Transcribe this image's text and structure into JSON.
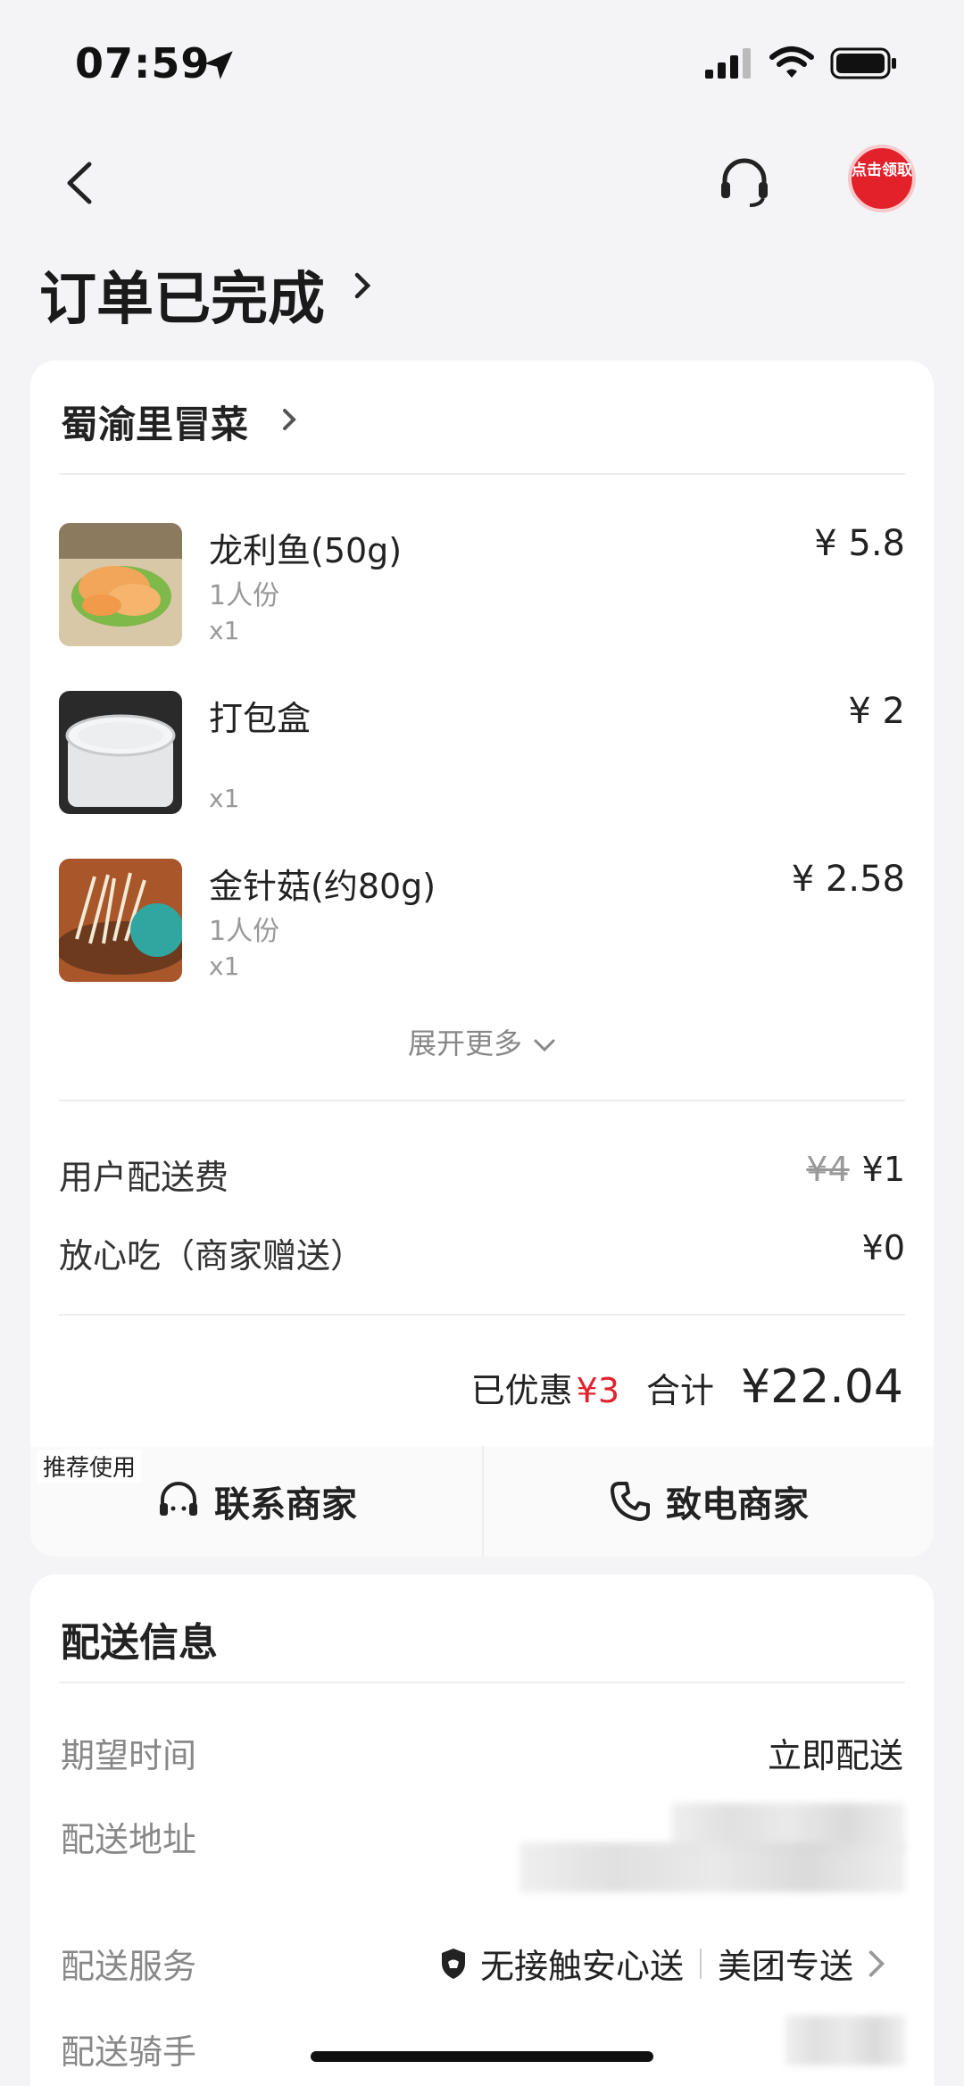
{
  "status_bar": {
    "time": "07:59"
  },
  "nav": {
    "coupon_text": "点击领取"
  },
  "page": {
    "title": "订单已完成"
  },
  "order": {
    "shop_name": "蜀渝里冒菜",
    "items": [
      {
        "name": "龙利鱼(50g)",
        "spec": "1人份",
        "qty": "x1",
        "price": "¥ 5.8"
      },
      {
        "name": "打包盒",
        "spec": "",
        "qty": "x1",
        "price": "¥ 2"
      },
      {
        "name": "金针菇(约80g)",
        "spec": "1人份",
        "qty": "x1",
        "price": "¥ 2.58"
      }
    ],
    "expand_label": "展开更多",
    "fees": [
      {
        "label": "用户配送费",
        "original": "¥4",
        "value": "¥1"
      },
      {
        "label": "放心吃（商家赠送）",
        "value": "¥0"
      }
    ],
    "discount_label": "已优惠",
    "discount_value": "¥3",
    "total_label": "合计",
    "total_value": "¥22.04",
    "recommend_tag": "推荐使用",
    "contact_merchant": "联系商家",
    "call_merchant": "致电商家"
  },
  "delivery": {
    "title": "配送信息",
    "expected_time_label": "期望时间",
    "expected_time_value": "立即配送",
    "address_label": "配送地址",
    "service_label": "配送服务",
    "service_contactless": "无接触安心送",
    "service_provider": "美团专送",
    "rider_label": "配送骑手"
  },
  "colors": {
    "accent_red": "#e2212b",
    "background": "#f4f4f6"
  }
}
